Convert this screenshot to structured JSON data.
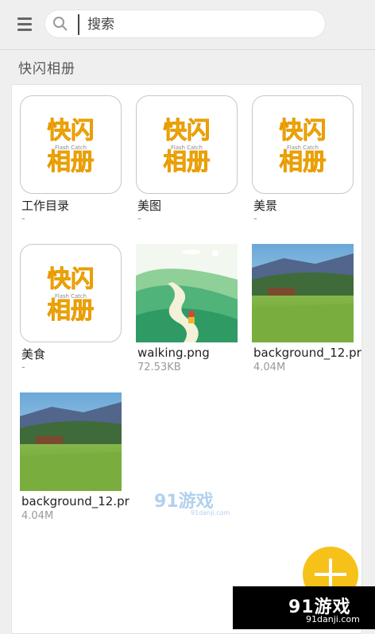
{
  "search": {
    "placeholder": "搜索"
  },
  "album": {
    "title": "快闪相册"
  },
  "logo_text": {
    "line1": "快闪",
    "sub": "Flash Catch",
    "line2": "相册"
  },
  "tiles": [
    {
      "name": "工作目录",
      "meta": "-"
    },
    {
      "name": "美图",
      "meta": "-"
    },
    {
      "name": "美景",
      "meta": "-"
    },
    {
      "name": "美食",
      "meta": "-"
    },
    {
      "name": "walking.png",
      "meta": "72.53KB"
    },
    {
      "name": "background_12.pr",
      "meta": "4.04M"
    },
    {
      "name": "background_12.pr",
      "meta": "4.04M"
    }
  ],
  "watermark": {
    "center_text": "91游戏",
    "center_sub": "91danji.com",
    "corner_text": "91游戏",
    "corner_sub": "91danji.com"
  },
  "colors": {
    "accent": "#f6c21a",
    "logo_yellow": "#f4c20d",
    "logo_orange": "#e89a00"
  },
  "icons": {
    "menu": "hamburger-icon",
    "search": "search-icon",
    "add": "plus-icon"
  }
}
